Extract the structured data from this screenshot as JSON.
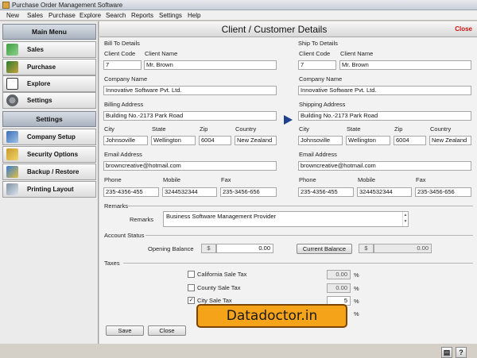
{
  "app": {
    "title": "Purchase Order Management Software"
  },
  "menu": [
    "New",
    "Sales",
    "Purchase",
    "Explore",
    "Search",
    "Reports",
    "Settings",
    "Help"
  ],
  "sidebar": {
    "main_menu": "Main Menu",
    "main_items": [
      {
        "label": "Sales",
        "icon": "chart-icon"
      },
      {
        "label": "Purchase",
        "icon": "purchase-icon"
      },
      {
        "label": "Explore",
        "icon": "tree-icon"
      },
      {
        "label": "Settings",
        "icon": "gear-icon"
      }
    ],
    "settings_head": "Settings",
    "settings_items": [
      {
        "label": "Company Setup",
        "icon": "company-icon"
      },
      {
        "label": "Security Options",
        "icon": "security-icon"
      },
      {
        "label": "Backup / Restore",
        "icon": "backup-icon"
      },
      {
        "label": "Printing Layout",
        "icon": "print-icon"
      }
    ]
  },
  "page": {
    "title": "Client / Customer Details",
    "close": "Close"
  },
  "bill": {
    "section": "Bill To Details",
    "client_code_label": "Client Code",
    "client_code": "7",
    "client_name_label": "Client Name",
    "client_name": "Mr. Brown",
    "company_name_label": "Company Name",
    "company_name": "Innovative Software Pvt. Ltd.",
    "address_label": "Billing Address",
    "address": "Building No.-2173 Park Road",
    "city_label": "City",
    "city": "Johnsoville",
    "state_label": "State",
    "state": "Wellington",
    "zip_label": "Zip",
    "zip": "6004",
    "country_label": "Country",
    "country": "New Zealand",
    "email_label": "Email Address",
    "email": "browncreative@hotmail.com",
    "phone_label": "Phone",
    "phone": "235-4356-455",
    "mobile_label": "Mobile",
    "mobile": "3244532344",
    "fax_label": "Fax",
    "fax": "235-3456-656"
  },
  "ship": {
    "section": "Ship To Details",
    "client_code_label": "Client Code",
    "client_code": "7",
    "client_name_label": "Client Name",
    "client_name": "Mr. Brown",
    "company_name_label": "Company Name",
    "company_name": "Innovative Software Pvt. Ltd.",
    "address_label": "Shipping Address",
    "address": "Building No.-2173 Park Road",
    "city_label": "City",
    "city": "Johnsoville",
    "state_label": "State",
    "state": "Wellington",
    "zip_label": "Zip",
    "zip": "6004",
    "country_label": "Country",
    "country": "New Zealand",
    "email_label": "Email Address",
    "email": "browncreative@hotmail.com",
    "phone_label": "Phone",
    "phone": "235-4356-455",
    "mobile_label": "Mobile",
    "mobile": "3244532344",
    "fax_label": "Fax",
    "fax": "235-3456-656"
  },
  "remarks": {
    "section": "Remarks",
    "label": "Remarks",
    "value": "Business Software Management Provider"
  },
  "account": {
    "section": "Account Status",
    "opening_label": "Opening Balance",
    "currency": "$",
    "opening_value": "0.00",
    "current_button": "Current Balance",
    "current_value": "0.00"
  },
  "taxes": {
    "section": "Taxes",
    "items": [
      {
        "label": "California Sale Tax",
        "checked": false,
        "value": "0.00"
      },
      {
        "label": "County Sale Tax",
        "checked": false,
        "value": "0.00"
      },
      {
        "label": "City Sale Tax",
        "checked": true,
        "value": "5"
      }
    ],
    "percent": "%"
  },
  "buttons": {
    "save": "Save",
    "close": "Close"
  },
  "watermark": "Datadoctor.in"
}
